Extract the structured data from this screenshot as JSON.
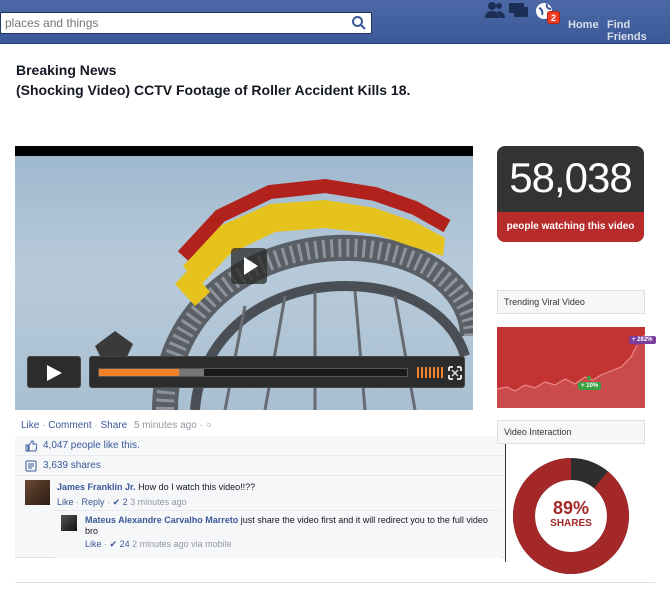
{
  "topbar": {
    "search_placeholder": "places and things",
    "notification_count": "2",
    "home_label": "Home",
    "find_friends_label": "Find Friends"
  },
  "headline": {
    "line1": "Breaking News",
    "line2": "(Shocking Video) CCTV Footage of Roller Accident Kills 18."
  },
  "video": {
    "progress": 0.26,
    "buffered": 0.08
  },
  "actions": {
    "like": "Like",
    "comment": "Comment",
    "share": "Share",
    "time": "5 minutes ago"
  },
  "stats": {
    "likes": "4,047 people like this.",
    "shares": "3,639 shares"
  },
  "comments": [
    {
      "author": "James Franklin Jr.",
      "text": "How do I watch this video!!??",
      "like": "Like",
      "reply": "Reply",
      "likes": "2",
      "time": "3 minutes ago"
    },
    {
      "author": "Mateus Alexandre Carvalho Marreto",
      "text": "just share the video first and it will redirect you to the full video bro",
      "like": "Like",
      "likes": "24",
      "time": "2 minutes ago via mobile"
    }
  ],
  "sidebar": {
    "watching_count": "58,038",
    "watching_caption": "people watching this video",
    "trending_label": "Trending Viral Video",
    "trend_tag_high": "+ 282%",
    "trend_tag_low": "+ 10%",
    "interaction_label": "Video Interaction",
    "shares_pct": "89%",
    "shares_label": "SHARES",
    "shares_fraction": 0.89
  },
  "colors": {
    "brand_blue": "#3b5998",
    "accent_red": "#b82b2b",
    "progress_orange": "#f0822c"
  }
}
